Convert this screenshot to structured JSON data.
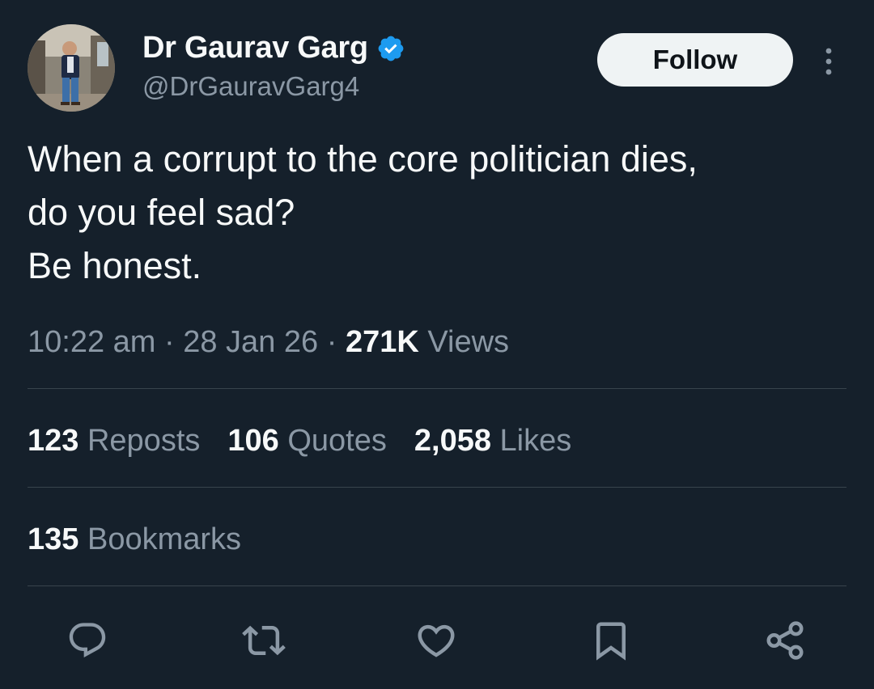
{
  "author": {
    "display_name": "Dr Gaurav Garg",
    "handle": "@DrGauravGarg4",
    "verified": true
  },
  "header": {
    "follow_label": "Follow"
  },
  "tweet": {
    "lines": [
      "When a corrupt to the core politician dies,",
      "do you feel sad?",
      "Be honest."
    ],
    "time": "10:22 am",
    "date": "28 Jan 26",
    "views_count": "271K",
    "views_label": "Views",
    "separator": "·"
  },
  "stats": {
    "reposts": {
      "count": "123",
      "label": "Reposts"
    },
    "quotes": {
      "count": "106",
      "label": "Quotes"
    },
    "likes": {
      "count": "2,058",
      "label": "Likes"
    },
    "bookmarks": {
      "count": "135",
      "label": "Bookmarks"
    }
  },
  "actions": [
    "reply-icon",
    "retweet-icon",
    "like-icon",
    "bookmark-icon",
    "share-icon"
  ],
  "colors": {
    "background": "#15202b",
    "text_primary": "#f7f9f9",
    "text_secondary": "#8b98a5",
    "verified_blue": "#1d9bf0",
    "divider": "#38444d",
    "follow_bg": "#eff3f4"
  }
}
